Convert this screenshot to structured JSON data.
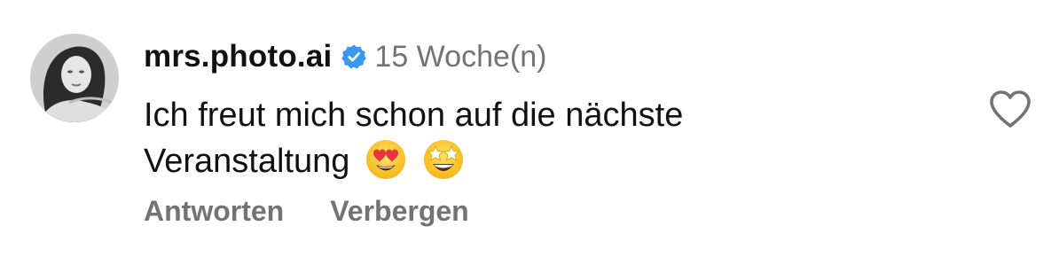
{
  "comment": {
    "username": "mrs.photo.ai",
    "verified": true,
    "timestamp": "15 Woche(n)",
    "text_line1": "Ich freut mich schon auf die nächste",
    "text_line2": "Veranstaltung",
    "emojis": [
      "smiling-face-with-heart-eyes",
      "star-struck"
    ],
    "actions": {
      "reply": "Antworten",
      "hide": "Verbergen"
    },
    "like_icon": "heart-outline-icon"
  },
  "colors": {
    "verified_blue": "#3897F0",
    "secondary_text": "#737373",
    "primary_text": "#111111"
  }
}
